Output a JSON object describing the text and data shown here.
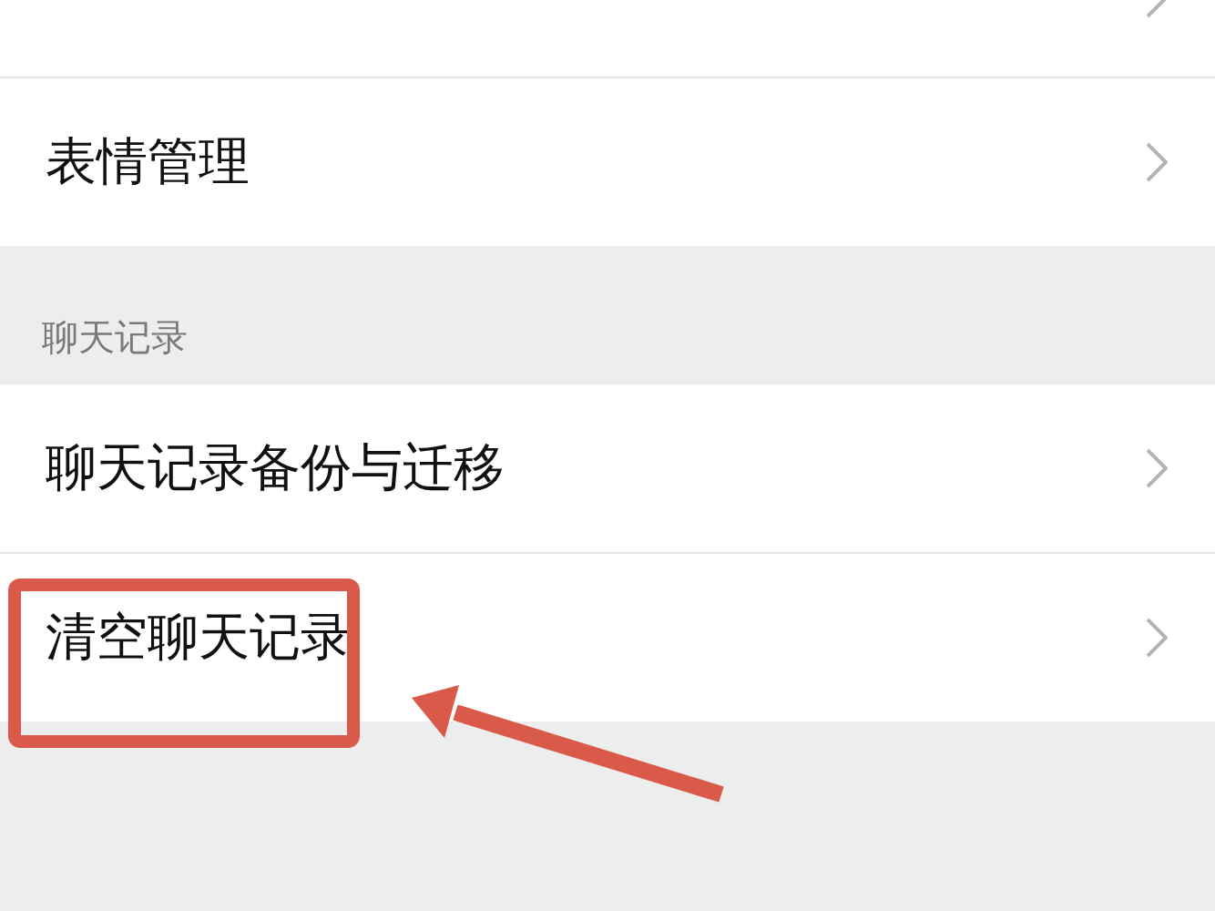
{
  "groups": [
    {
      "items": [
        {
          "kind": "cut"
        },
        {
          "kind": "row",
          "label": "表情管理"
        }
      ]
    },
    {
      "header": "聊天记录",
      "items": [
        {
          "kind": "row",
          "label": "聊天记录备份与迁移"
        },
        {
          "kind": "row",
          "label": "清空聊天记录"
        }
      ]
    }
  ],
  "annotation": {
    "highlight_box": true,
    "arrow": true
  }
}
